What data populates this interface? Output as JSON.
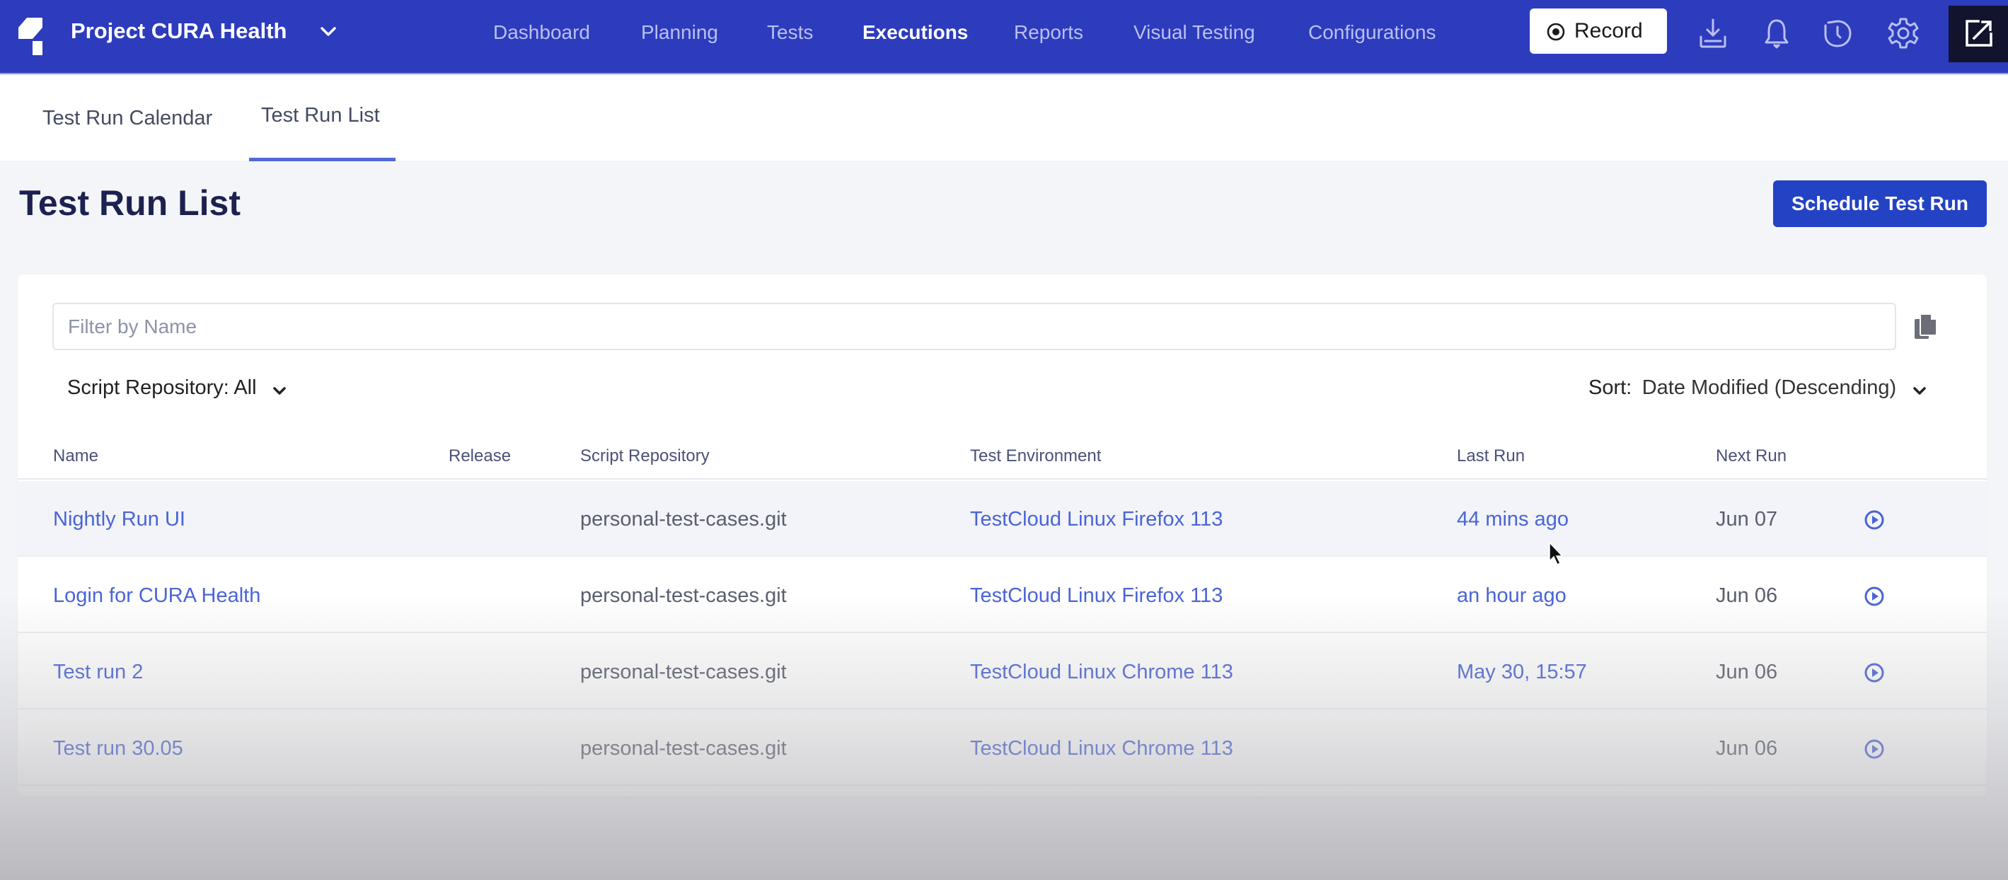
{
  "header": {
    "project_name": "Project CURA Health",
    "nav": [
      {
        "label": "Dashboard",
        "active": false
      },
      {
        "label": "Planning",
        "active": false
      },
      {
        "label": "Tests",
        "active": false
      },
      {
        "label": "Executions",
        "active": true
      },
      {
        "label": "Reports",
        "active": false
      },
      {
        "label": "Visual Testing",
        "active": false
      },
      {
        "label": "Configurations",
        "active": false
      }
    ],
    "record_label": "Record",
    "icons": [
      "download-icon",
      "bell-icon",
      "history-icon",
      "gear-icon",
      "external-link-icon"
    ],
    "bar_color": "#2d3bbd"
  },
  "tabs": [
    {
      "label": "Test Run Calendar",
      "active": false
    },
    {
      "label": "Test Run List",
      "active": true
    }
  ],
  "page": {
    "title": "Test Run List",
    "schedule_button": "Schedule Test Run",
    "accent_color": "#2342c4"
  },
  "filters": {
    "name_placeholder": "Filter by Name",
    "name_value": "",
    "script_repository": "Script Repository: All",
    "sort_label": "Sort:",
    "sort_value": "Date Modified (Descending)"
  },
  "table": {
    "columns": [
      "Name",
      "Release",
      "Script Repository",
      "Test Environment",
      "Last Run",
      "Next Run"
    ],
    "rows": [
      {
        "name": "Nightly Run UI",
        "release": "",
        "repo": "personal-test-cases.git",
        "environment": "TestCloud Linux Firefox 113",
        "last_run": "44 mins ago",
        "next_run": "Jun 07"
      },
      {
        "name": "Login for CURA Health",
        "release": "",
        "repo": "personal-test-cases.git",
        "environment": "TestCloud Linux Firefox 113",
        "last_run": "an hour ago",
        "next_run": "Jun 06"
      },
      {
        "name": "Test run 2",
        "release": "",
        "repo": "personal-test-cases.git",
        "environment": "TestCloud Linux Chrome 113",
        "last_run": "May 30, 15:57",
        "next_run": "Jun 06"
      },
      {
        "name": "Test run 30.05",
        "release": "",
        "repo": "personal-test-cases.git",
        "environment": "TestCloud Linux Chrome 113",
        "last_run": "",
        "next_run": "Jun 06"
      }
    ]
  }
}
